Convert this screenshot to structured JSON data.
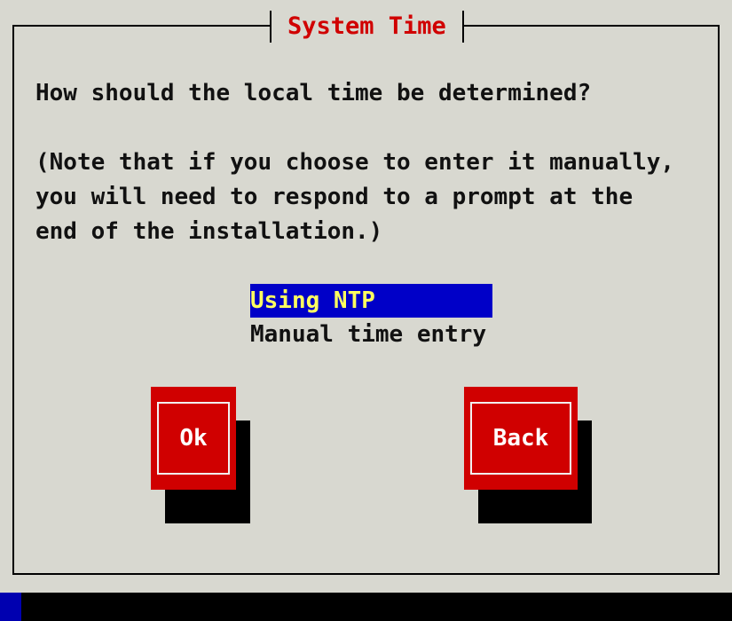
{
  "dialog": {
    "title": "System Time",
    "question": "How should the local time be determined?",
    "note_lines": [
      "(Note that if you choose to enter it manually,",
      "you will need to respond to a prompt at the",
      "end of the installation.)"
    ]
  },
  "options": [
    {
      "label": "Using NTP",
      "selected": true
    },
    {
      "label": "Manual time entry",
      "selected": false
    }
  ],
  "buttons": {
    "ok_label": "Ok",
    "back_label": "Back"
  },
  "colors": {
    "background": "#0000b0",
    "dialog": "#d8d8d0",
    "accent_red": "#d00000",
    "selection_bg": "#0000c8",
    "selection_fg": "#ffff60"
  }
}
